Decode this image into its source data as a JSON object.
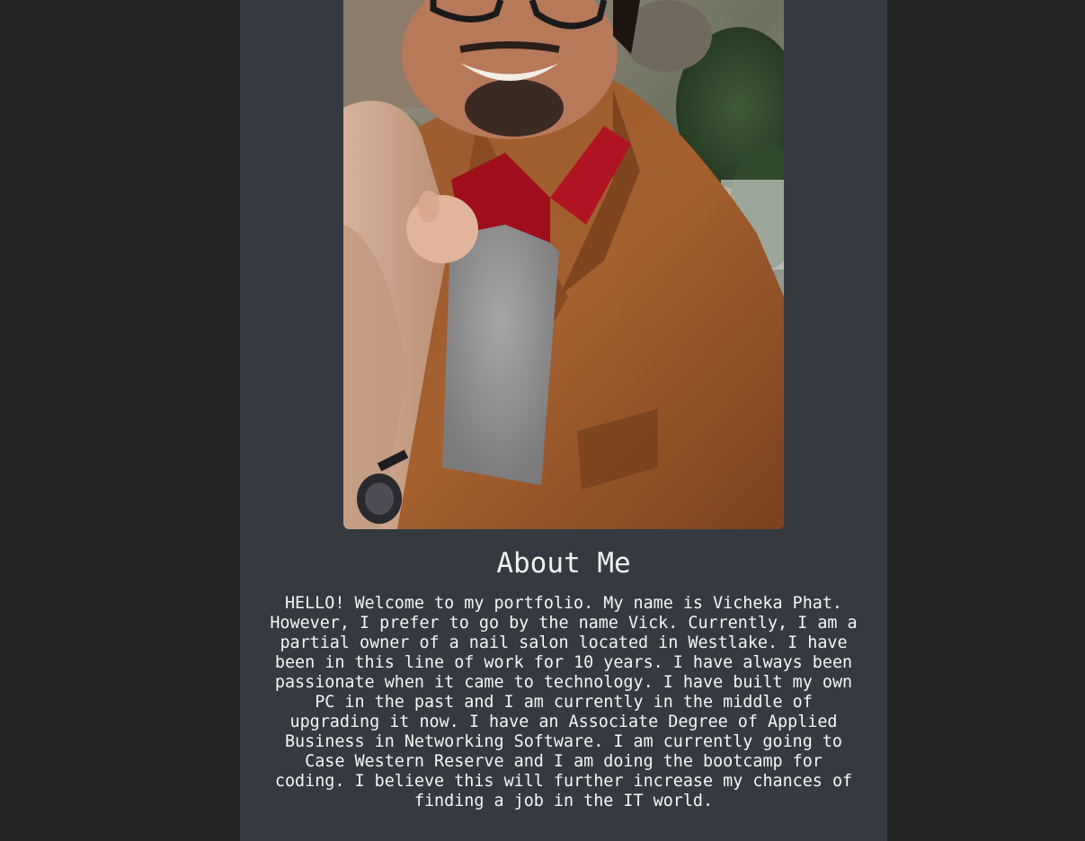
{
  "colors": {
    "background": "#242424",
    "column": "#343a40",
    "text": "#f5f5f5"
  },
  "profile_photo": {
    "icon": "profile-photo"
  },
  "about": {
    "title": "About Me",
    "body": "HELLO! Welcome to my portfolio. My name is Vicheka Phat. However, I prefer to go by the name Vick. Currently, I am a partial owner of a nail salon located in Westlake. I have been in this line of work for 10 years. I have always been passionate when it came to technology. I have built my own PC in the past and I am currently in the middle of upgrading it now. I have an Associate Degree of Applied Business in Networking Software. I am currently going to Case Western Reserve and I am doing the bootcamp for coding. I believe this will further increase my chances of finding a job in the IT world."
  }
}
